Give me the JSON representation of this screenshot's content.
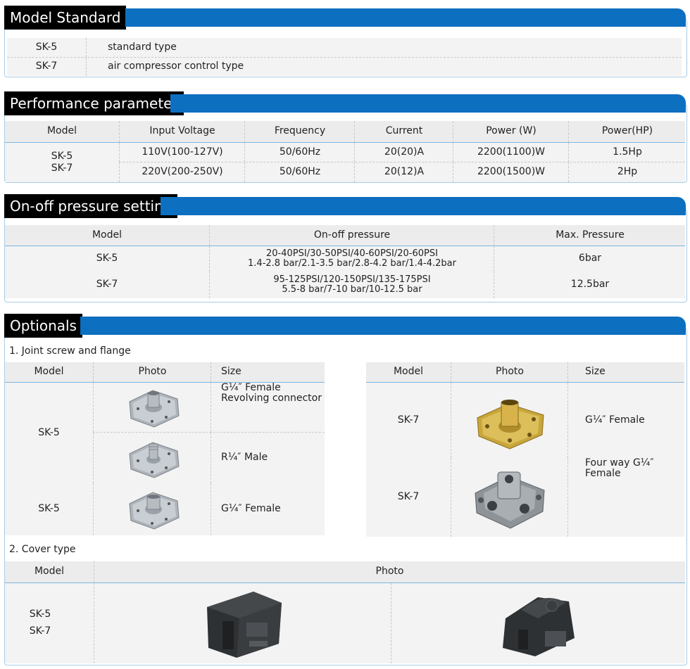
{
  "model_standard": {
    "title": "Model Standard",
    "rows": [
      {
        "model": "SK-5",
        "desc": "standard type"
      },
      {
        "model": "SK-7",
        "desc": "air compressor control type"
      }
    ]
  },
  "performance": {
    "title": "Performance parameter",
    "headers": [
      "Model",
      "Input Voltage",
      "Frequency",
      "Current",
      "Power (W)",
      "Power(HP)"
    ],
    "models": [
      "SK-5",
      "SK-7"
    ],
    "rows": [
      [
        "110V(100-127V)",
        "50/60Hz",
        "20(20)A",
        "2200(1100)W",
        "1.5Hp"
      ],
      [
        "220V(200-250V)",
        "50/60Hz",
        "20(12)A",
        "2200(1500)W",
        "2Hp"
      ]
    ]
  },
  "pressure": {
    "title": "On-off pressure setting",
    "headers": [
      "Model",
      "On-off pressure",
      "Max. Pressure"
    ],
    "rows": [
      {
        "model": "SK-5",
        "line1": "20-40PSI/30-50PSI/40-60PSI/20-60PSI",
        "line2": "1.4-2.8 bar/2.1-3.5 bar/2.8-4.2 bar/1.4-4.2bar",
        "max": "6bar"
      },
      {
        "model": "SK-7",
        "line1": "95-125PSI/120-150PSI/135-175PSI",
        "line2": "5.5-8 bar/7-10 bar/10-12.5 bar",
        "max": "12.5bar"
      }
    ]
  },
  "optionals": {
    "title": "Optionals",
    "joint": {
      "subtitle": "1. Joint screw and flange",
      "headers": [
        "Model",
        "Photo",
        "Size"
      ],
      "left": {
        "model_a": "SK-5",
        "size_a1_line1": "G¼″ Female",
        "size_a1_line2": "Revolving connector",
        "size_a2": "R¼″ Male",
        "model_b": "SK-5",
        "size_b": "G¼″ Female"
      },
      "right": {
        "model_a": "SK-7",
        "size_a": "G¼″ Female",
        "model_b": "SK-7",
        "size_b_line1": "Four way G¼″",
        "size_b_line2": "Female"
      }
    },
    "cover": {
      "subtitle": "2. Cover type",
      "headers": [
        "Model",
        "Photo"
      ],
      "models": [
        "SK-5",
        "SK-7"
      ]
    }
  },
  "colors": {
    "accent": "#0d6fc0",
    "title_bg": "#000000",
    "header_bg": "#ececec"
  }
}
